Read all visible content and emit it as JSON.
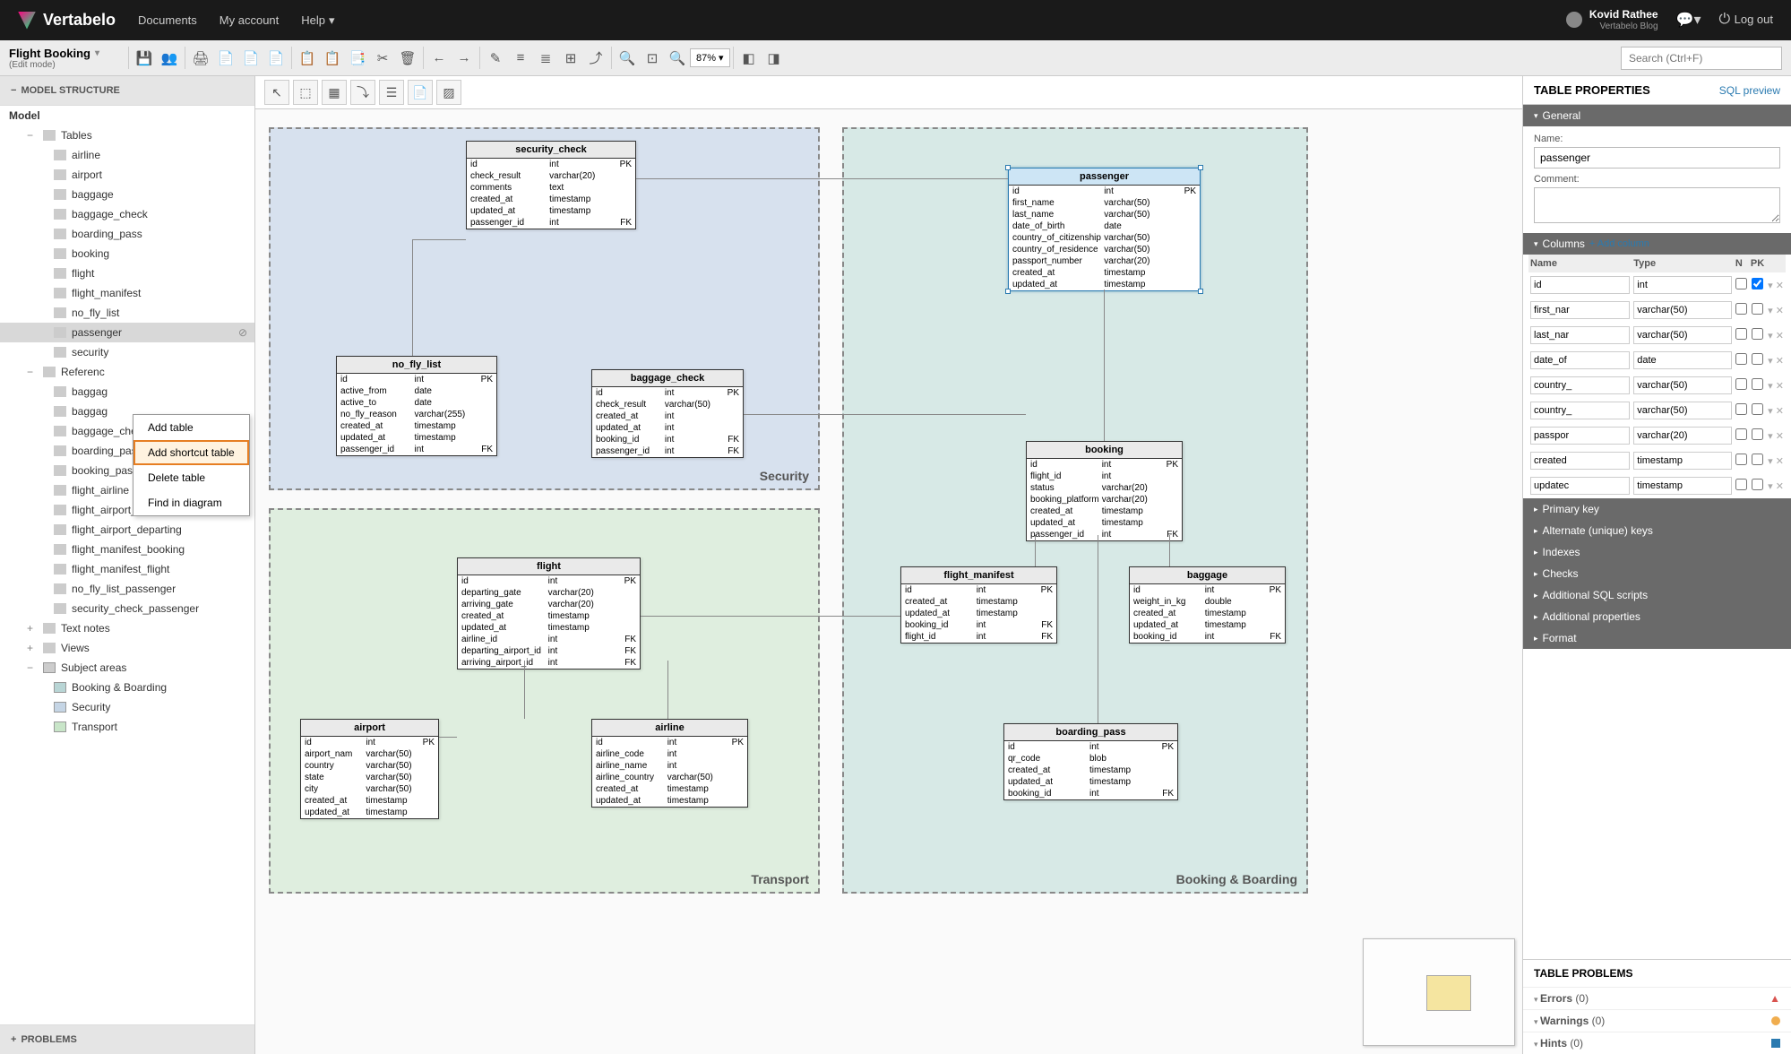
{
  "brand": "Vertabelo",
  "topnav": {
    "documents": "Documents",
    "account": "My account",
    "help": "Help"
  },
  "user": {
    "name": "Kovid Rathee",
    "sub": "Vertabelo Blog"
  },
  "logout": "Log out",
  "document": {
    "title": "Flight Booking",
    "mode": "(Edit mode)"
  },
  "zoom": "87%",
  "search_placeholder": "Search (Ctrl+F)",
  "left_panel": {
    "header": "MODEL STRUCTURE",
    "root": "Model",
    "tables_label": "Tables",
    "tables": [
      "airline",
      "airport",
      "baggage",
      "baggage_check",
      "boarding_pass",
      "booking",
      "flight",
      "flight_manifest",
      "no_fly_list",
      "passenger",
      "security"
    ],
    "selected_table": "passenger",
    "references_label": "Referenc",
    "references": [
      "baggag",
      "baggag",
      "baggage_check_passenger",
      "boarding_pass_booking",
      "booking_passenger",
      "flight_airline",
      "flight_airport_arriving",
      "flight_airport_departing",
      "flight_manifest_booking",
      "flight_manifest_flight",
      "no_fly_list_passenger",
      "security_check_passenger"
    ],
    "text_notes": "Text notes",
    "views": "Views",
    "subject_areas_label": "Subject areas",
    "subject_areas": [
      "Booking & Boarding",
      "Security",
      "Transport"
    ],
    "problems": "PROBLEMS"
  },
  "context_menu": {
    "add_table": "Add table",
    "add_shortcut": "Add shortcut table",
    "delete_table": "Delete table",
    "find": "Find in diagram"
  },
  "areas": {
    "security": "Security",
    "transport": "Transport",
    "booking": "Booking & Boarding"
  },
  "er": {
    "security_check": {
      "name": "security_check",
      "cols": [
        [
          "id",
          "int",
          "PK"
        ],
        [
          "check_result",
          "varchar(20)",
          ""
        ],
        [
          "comments",
          "text",
          ""
        ],
        [
          "created_at",
          "timestamp",
          ""
        ],
        [
          "updated_at",
          "timestamp",
          ""
        ],
        [
          "passenger_id",
          "int",
          "FK"
        ]
      ]
    },
    "no_fly_list": {
      "name": "no_fly_list",
      "cols": [
        [
          "id",
          "int",
          "PK"
        ],
        [
          "active_from",
          "date",
          ""
        ],
        [
          "active_to",
          "date",
          ""
        ],
        [
          "no_fly_reason",
          "varchar(255)",
          ""
        ],
        [
          "created_at",
          "timestamp",
          ""
        ],
        [
          "updated_at",
          "timestamp",
          ""
        ],
        [
          "passenger_id",
          "int",
          "FK"
        ]
      ]
    },
    "baggage_check": {
      "name": "baggage_check",
      "cols": [
        [
          "id",
          "int",
          "PK"
        ],
        [
          "check_result",
          "varchar(50)",
          ""
        ],
        [
          "created_at",
          "int",
          ""
        ],
        [
          "updated_at",
          "int",
          ""
        ],
        [
          "booking_id",
          "int",
          "FK"
        ],
        [
          "passenger_id",
          "int",
          "FK"
        ]
      ]
    },
    "passenger": {
      "name": "passenger",
      "cols": [
        [
          "id",
          "int",
          "PK"
        ],
        [
          "first_name",
          "varchar(50)",
          ""
        ],
        [
          "last_name",
          "varchar(50)",
          ""
        ],
        [
          "date_of_birth",
          "date",
          ""
        ],
        [
          "country_of_citizenship",
          "varchar(50)",
          ""
        ],
        [
          "country_of_residence",
          "varchar(50)",
          ""
        ],
        [
          "passport_number",
          "varchar(20)",
          ""
        ],
        [
          "created_at",
          "timestamp",
          ""
        ],
        [
          "updated_at",
          "timestamp",
          ""
        ]
      ]
    },
    "booking": {
      "name": "booking",
      "cols": [
        [
          "id",
          "int",
          "PK"
        ],
        [
          "flight_id",
          "int",
          ""
        ],
        [
          "status",
          "varchar(20)",
          ""
        ],
        [
          "booking_platform",
          "varchar(20)",
          ""
        ],
        [
          "created_at",
          "timestamp",
          ""
        ],
        [
          "updated_at",
          "timestamp",
          ""
        ],
        [
          "passenger_id",
          "int",
          "FK"
        ]
      ]
    },
    "flight_manifest": {
      "name": "flight_manifest",
      "cols": [
        [
          "id",
          "int",
          "PK"
        ],
        [
          "created_at",
          "timestamp",
          ""
        ],
        [
          "updated_at",
          "timestamp",
          ""
        ],
        [
          "booking_id",
          "int",
          "FK"
        ],
        [
          "flight_id",
          "int",
          "FK"
        ]
      ]
    },
    "baggage": {
      "name": "baggage",
      "cols": [
        [
          "id",
          "int",
          "PK"
        ],
        [
          "weight_in_kg",
          "double",
          ""
        ],
        [
          "created_at",
          "timestamp",
          ""
        ],
        [
          "updated_at",
          "timestamp",
          ""
        ],
        [
          "booking_id",
          "int",
          "FK"
        ]
      ]
    },
    "boarding_pass": {
      "name": "boarding_pass",
      "cols": [
        [
          "id",
          "int",
          "PK"
        ],
        [
          "qr_code",
          "blob",
          ""
        ],
        [
          "created_at",
          "timestamp",
          ""
        ],
        [
          "updated_at",
          "timestamp",
          ""
        ],
        [
          "booking_id",
          "int",
          "FK"
        ]
      ]
    },
    "flight": {
      "name": "flight",
      "cols": [
        [
          "id",
          "int",
          "PK"
        ],
        [
          "departing_gate",
          "varchar(20)",
          ""
        ],
        [
          "arriving_gate",
          "varchar(20)",
          ""
        ],
        [
          "created_at",
          "timestamp",
          ""
        ],
        [
          "updated_at",
          "timestamp",
          ""
        ],
        [
          "airline_id",
          "int",
          "FK"
        ],
        [
          "departing_airport_id",
          "int",
          "FK"
        ],
        [
          "arriving_airport_id",
          "int",
          "FK"
        ]
      ]
    },
    "airport": {
      "name": "airport",
      "cols": [
        [
          "id",
          "int",
          "PK"
        ],
        [
          "airport_nam",
          "varchar(50)",
          ""
        ],
        [
          "country",
          "varchar(50)",
          ""
        ],
        [
          "state",
          "varchar(50)",
          ""
        ],
        [
          "city",
          "varchar(50)",
          ""
        ],
        [
          "created_at",
          "timestamp",
          ""
        ],
        [
          "updated_at",
          "timestamp",
          ""
        ]
      ]
    },
    "airline": {
      "name": "airline",
      "cols": [
        [
          "id",
          "int",
          "PK"
        ],
        [
          "airline_code",
          "int",
          ""
        ],
        [
          "airline_name",
          "int",
          ""
        ],
        [
          "airline_country",
          "varchar(50)",
          ""
        ],
        [
          "created_at",
          "timestamp",
          ""
        ],
        [
          "updated_at",
          "timestamp",
          ""
        ]
      ]
    }
  },
  "right_panel": {
    "title": "TABLE PROPERTIES",
    "sql_preview": "SQL preview",
    "general": "General",
    "name_label": "Name:",
    "name_value": "passenger",
    "comment_label": "Comment:",
    "columns_title": "Columns",
    "add_column": "+ Add column",
    "col_headers": {
      "name": "Name",
      "type": "Type",
      "n": "N",
      "pk": "PK"
    },
    "cols": [
      {
        "name": "id",
        "type": "int",
        "n": false,
        "pk": true
      },
      {
        "name": "first_nar",
        "type": "varchar(50)",
        "n": false,
        "pk": false
      },
      {
        "name": "last_nar",
        "type": "varchar(50)",
        "n": false,
        "pk": false
      },
      {
        "name": "date_of",
        "type": "date",
        "n": false,
        "pk": false
      },
      {
        "name": "country_",
        "type": "varchar(50)",
        "n": false,
        "pk": false
      },
      {
        "name": "country_",
        "type": "varchar(50)",
        "n": false,
        "pk": false
      },
      {
        "name": "passpor",
        "type": "varchar(20)",
        "n": false,
        "pk": false
      },
      {
        "name": "created",
        "type": "timestamp",
        "n": false,
        "pk": false
      },
      {
        "name": "updatec",
        "type": "timestamp",
        "n": false,
        "pk": false
      }
    ],
    "sections": [
      "Primary key",
      "Alternate (unique) keys",
      "Indexes",
      "Checks",
      "Additional SQL scripts",
      "Additional properties",
      "Format"
    ],
    "problems_title": "TABLE PROBLEMS",
    "errors": "Errors",
    "errors_count": "(0)",
    "warnings": "Warnings",
    "warnings_count": "(0)",
    "hints": "Hints",
    "hints_count": "(0)"
  }
}
